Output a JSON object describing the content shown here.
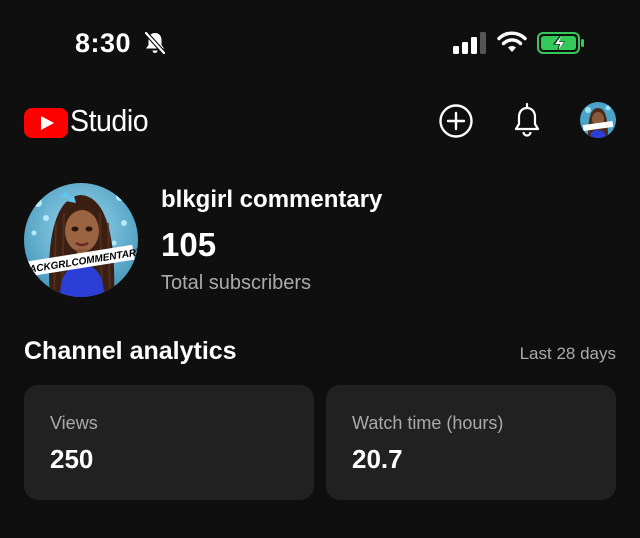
{
  "status_bar": {
    "time": "8:30",
    "icons": [
      "bell-slash-icon",
      "signal-icon",
      "wifi-icon",
      "battery-charging-icon"
    ],
    "battery_color": "#34c759"
  },
  "header": {
    "logo_icon": "youtube-play-icon",
    "brand_color": "#ff0000",
    "title": "Studio",
    "actions": [
      "create-plus-icon",
      "notifications-bell-icon",
      "account-avatar"
    ]
  },
  "channel": {
    "name": "blkgirl commentary",
    "subscribers": "105",
    "subscribers_label": "Total subscribers",
    "avatar_banner_text": "BLACKGRLCOMMENTARY"
  },
  "analytics": {
    "title": "Channel analytics",
    "period": "Last 28 days",
    "cards": [
      {
        "label": "Views",
        "value": "250"
      },
      {
        "label": "Watch time (hours)",
        "value": "20.7"
      }
    ]
  }
}
